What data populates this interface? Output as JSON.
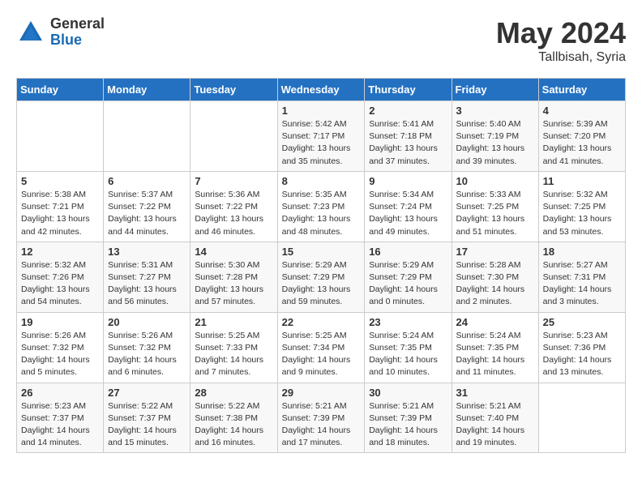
{
  "header": {
    "logo_general": "General",
    "logo_blue": "Blue",
    "month_year": "May 2024",
    "location": "Tallbisah, Syria"
  },
  "days_of_week": [
    "Sunday",
    "Monday",
    "Tuesday",
    "Wednesday",
    "Thursday",
    "Friday",
    "Saturday"
  ],
  "weeks": [
    [
      {
        "day": "",
        "info": ""
      },
      {
        "day": "",
        "info": ""
      },
      {
        "day": "",
        "info": ""
      },
      {
        "day": "1",
        "info": "Sunrise: 5:42 AM\nSunset: 7:17 PM\nDaylight: 13 hours\nand 35 minutes."
      },
      {
        "day": "2",
        "info": "Sunrise: 5:41 AM\nSunset: 7:18 PM\nDaylight: 13 hours\nand 37 minutes."
      },
      {
        "day": "3",
        "info": "Sunrise: 5:40 AM\nSunset: 7:19 PM\nDaylight: 13 hours\nand 39 minutes."
      },
      {
        "day": "4",
        "info": "Sunrise: 5:39 AM\nSunset: 7:20 PM\nDaylight: 13 hours\nand 41 minutes."
      }
    ],
    [
      {
        "day": "5",
        "info": "Sunrise: 5:38 AM\nSunset: 7:21 PM\nDaylight: 13 hours\nand 42 minutes."
      },
      {
        "day": "6",
        "info": "Sunrise: 5:37 AM\nSunset: 7:22 PM\nDaylight: 13 hours\nand 44 minutes."
      },
      {
        "day": "7",
        "info": "Sunrise: 5:36 AM\nSunset: 7:22 PM\nDaylight: 13 hours\nand 46 minutes."
      },
      {
        "day": "8",
        "info": "Sunrise: 5:35 AM\nSunset: 7:23 PM\nDaylight: 13 hours\nand 48 minutes."
      },
      {
        "day": "9",
        "info": "Sunrise: 5:34 AM\nSunset: 7:24 PM\nDaylight: 13 hours\nand 49 minutes."
      },
      {
        "day": "10",
        "info": "Sunrise: 5:33 AM\nSunset: 7:25 PM\nDaylight: 13 hours\nand 51 minutes."
      },
      {
        "day": "11",
        "info": "Sunrise: 5:32 AM\nSunset: 7:25 PM\nDaylight: 13 hours\nand 53 minutes."
      }
    ],
    [
      {
        "day": "12",
        "info": "Sunrise: 5:32 AM\nSunset: 7:26 PM\nDaylight: 13 hours\nand 54 minutes."
      },
      {
        "day": "13",
        "info": "Sunrise: 5:31 AM\nSunset: 7:27 PM\nDaylight: 13 hours\nand 56 minutes."
      },
      {
        "day": "14",
        "info": "Sunrise: 5:30 AM\nSunset: 7:28 PM\nDaylight: 13 hours\nand 57 minutes."
      },
      {
        "day": "15",
        "info": "Sunrise: 5:29 AM\nSunset: 7:29 PM\nDaylight: 13 hours\nand 59 minutes."
      },
      {
        "day": "16",
        "info": "Sunrise: 5:29 AM\nSunset: 7:29 PM\nDaylight: 14 hours\nand 0 minutes."
      },
      {
        "day": "17",
        "info": "Sunrise: 5:28 AM\nSunset: 7:30 PM\nDaylight: 14 hours\nand 2 minutes."
      },
      {
        "day": "18",
        "info": "Sunrise: 5:27 AM\nSunset: 7:31 PM\nDaylight: 14 hours\nand 3 minutes."
      }
    ],
    [
      {
        "day": "19",
        "info": "Sunrise: 5:26 AM\nSunset: 7:32 PM\nDaylight: 14 hours\nand 5 minutes."
      },
      {
        "day": "20",
        "info": "Sunrise: 5:26 AM\nSunset: 7:32 PM\nDaylight: 14 hours\nand 6 minutes."
      },
      {
        "day": "21",
        "info": "Sunrise: 5:25 AM\nSunset: 7:33 PM\nDaylight: 14 hours\nand 7 minutes."
      },
      {
        "day": "22",
        "info": "Sunrise: 5:25 AM\nSunset: 7:34 PM\nDaylight: 14 hours\nand 9 minutes."
      },
      {
        "day": "23",
        "info": "Sunrise: 5:24 AM\nSunset: 7:35 PM\nDaylight: 14 hours\nand 10 minutes."
      },
      {
        "day": "24",
        "info": "Sunrise: 5:24 AM\nSunset: 7:35 PM\nDaylight: 14 hours\nand 11 minutes."
      },
      {
        "day": "25",
        "info": "Sunrise: 5:23 AM\nSunset: 7:36 PM\nDaylight: 14 hours\nand 13 minutes."
      }
    ],
    [
      {
        "day": "26",
        "info": "Sunrise: 5:23 AM\nSunset: 7:37 PM\nDaylight: 14 hours\nand 14 minutes."
      },
      {
        "day": "27",
        "info": "Sunrise: 5:22 AM\nSunset: 7:37 PM\nDaylight: 14 hours\nand 15 minutes."
      },
      {
        "day": "28",
        "info": "Sunrise: 5:22 AM\nSunset: 7:38 PM\nDaylight: 14 hours\nand 16 minutes."
      },
      {
        "day": "29",
        "info": "Sunrise: 5:21 AM\nSunset: 7:39 PM\nDaylight: 14 hours\nand 17 minutes."
      },
      {
        "day": "30",
        "info": "Sunrise: 5:21 AM\nSunset: 7:39 PM\nDaylight: 14 hours\nand 18 minutes."
      },
      {
        "day": "31",
        "info": "Sunrise: 5:21 AM\nSunset: 7:40 PM\nDaylight: 14 hours\nand 19 minutes."
      },
      {
        "day": "",
        "info": ""
      }
    ]
  ]
}
